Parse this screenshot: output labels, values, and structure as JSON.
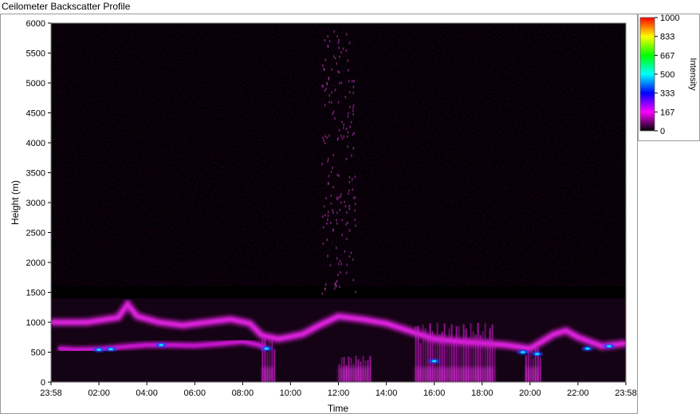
{
  "window_title": "Ceilometer Backscatter Profile",
  "chart_data": {
    "type": "heatmap",
    "title": "Ceilometer Backscatter Profile",
    "xlabel": "Time",
    "ylabel": "Height (m)",
    "x_ticks": [
      "23:58",
      "02:00",
      "04:00",
      "06:00",
      "08:00",
      "10:00",
      "12:00",
      "14:00",
      "16:00",
      "18:00",
      "20:00",
      "22:00",
      "23:58"
    ],
    "y_ticks": [
      0,
      500,
      1000,
      1500,
      2000,
      2500,
      3000,
      3500,
      4000,
      4500,
      5000,
      5500,
      6000
    ],
    "ylim": [
      0,
      6000
    ],
    "x_range_hours": [
      0,
      24
    ],
    "colorbar": {
      "label": "Intensity",
      "ticks": [
        "0",
        "167",
        "333",
        "500",
        "667",
        "833",
        "1000"
      ],
      "range": [
        0,
        1000
      ],
      "colors": [
        "#000000",
        "#ff00ff",
        "#0000ff",
        "#00ffff",
        "#00ff00",
        "#ffff00",
        "#ff0000"
      ]
    },
    "features": {
      "cloud_layer_lower": [
        {
          "t": 0.3,
          "h": 560
        },
        {
          "t": 1.0,
          "h": 540
        },
        {
          "t": 2.0,
          "h": 550
        },
        {
          "t": 3.0,
          "h": 590
        },
        {
          "t": 4.0,
          "h": 620
        },
        {
          "t": 5.0,
          "h": 620
        },
        {
          "t": 6.0,
          "h": 610
        },
        {
          "t": 7.0,
          "h": 640
        },
        {
          "t": 8.0,
          "h": 680
        },
        {
          "t": 8.7,
          "h": 620
        },
        {
          "t": 9.0,
          "h": 560
        }
      ],
      "aerosol_layer_upper": [
        {
          "t": 0.0,
          "h": 1000
        },
        {
          "t": 1.5,
          "h": 1000
        },
        {
          "t": 2.8,
          "h": 1080
        },
        {
          "t": 3.2,
          "h": 1300
        },
        {
          "t": 3.6,
          "h": 1100
        },
        {
          "t": 4.5,
          "h": 1000
        },
        {
          "t": 5.5,
          "h": 950
        },
        {
          "t": 6.5,
          "h": 1000
        },
        {
          "t": 7.5,
          "h": 1050
        },
        {
          "t": 8.3,
          "h": 980
        },
        {
          "t": 8.8,
          "h": 780
        },
        {
          "t": 9.5,
          "h": 720
        },
        {
          "t": 10.5,
          "h": 800
        },
        {
          "t": 11.2,
          "h": 950
        },
        {
          "t": 12.0,
          "h": 1100
        },
        {
          "t": 13.0,
          "h": 1050
        },
        {
          "t": 14.0,
          "h": 980
        },
        {
          "t": 15.0,
          "h": 850
        },
        {
          "t": 16.0,
          "h": 720
        },
        {
          "t": 17.0,
          "h": 680
        },
        {
          "t": 18.0,
          "h": 650
        },
        {
          "t": 19.0,
          "h": 620
        },
        {
          "t": 20.0,
          "h": 560
        },
        {
          "t": 21.0,
          "h": 800
        },
        {
          "t": 21.5,
          "h": 860
        },
        {
          "t": 22.0,
          "h": 750
        },
        {
          "t": 23.0,
          "h": 600
        },
        {
          "t": 24.0,
          "h": 650
        }
      ],
      "precipitation_bands": [
        {
          "t0": 15.2,
          "t1": 18.5,
          "top": 900
        },
        {
          "t0": 19.8,
          "t1": 20.4,
          "top": 550
        },
        {
          "t0": 8.8,
          "t1": 9.3,
          "top": 700
        },
        {
          "t0": 12.0,
          "t1": 13.3,
          "top": 400
        }
      ]
    }
  }
}
